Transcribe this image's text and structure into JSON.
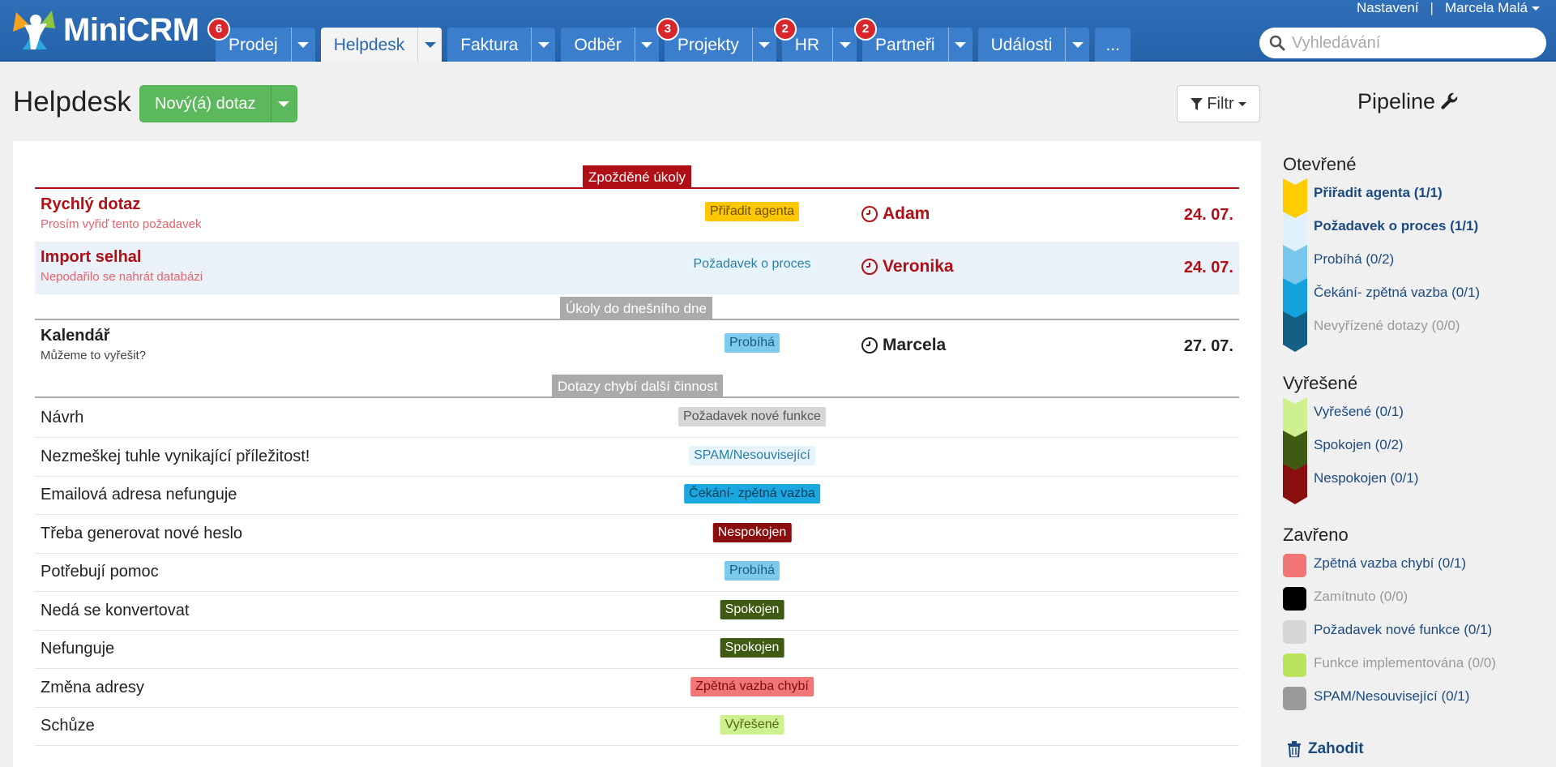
{
  "app": {
    "name": "MiniCRM"
  },
  "nav": {
    "tabs": [
      {
        "label": "Prodej",
        "badge": "6",
        "active": false
      },
      {
        "label": "Helpdesk",
        "badge": "",
        "active": true
      },
      {
        "label": "Faktura",
        "badge": "",
        "active": false
      },
      {
        "label": "Odběr",
        "badge": "",
        "active": false
      },
      {
        "label": "Projekty",
        "badge": "3",
        "active": false
      },
      {
        "label": "HR",
        "badge": "2",
        "active": false
      },
      {
        "label": "Partneři",
        "badge": "2",
        "active": false
      },
      {
        "label": "Události",
        "badge": "",
        "active": false
      }
    ],
    "more_label": "..."
  },
  "userbar": {
    "settings": "Nastavení",
    "separator": "|",
    "user": "Marcela Malá"
  },
  "search": {
    "placeholder": "Vyhledávání"
  },
  "header": {
    "title": "Helpdesk",
    "new_button": "Nový(á) dotaz",
    "filter_button": "Filtr"
  },
  "sections": {
    "overdue": {
      "label": "Zpožděné úkoly",
      "color": "#b00f15",
      "rows": [
        {
          "title": "Rychlý dotaz",
          "subtitle": "Prosím vyřiď tento požadavek",
          "tag": "Přiřadit agenta",
          "tag_bg": "#ffc700",
          "tag_fg": "#6b5000",
          "agent": "Adam",
          "date": "24. 07.",
          "highlight": false
        },
        {
          "title": "Import selhal",
          "subtitle": "Nepodařilo se nahrát databázi",
          "tag": "Požadavek o proces",
          "tag_bg": "#e8f4fb",
          "tag_fg": "#2c7ea8",
          "agent": "Veronika",
          "date": "24. 07.",
          "highlight": true
        }
      ]
    },
    "today": {
      "label": "Úkoly do dnešního dne",
      "color": "#aaaaaa",
      "rows": [
        {
          "title": "Kalendář",
          "subtitle": "Můžeme to vyřešit?",
          "tag": "Probíhá",
          "tag_bg": "#7ccbee",
          "tag_fg": "#1e5a7a",
          "agent": "Marcela",
          "date": "27. 07.",
          "highlight": false
        }
      ]
    },
    "no_activity": {
      "label": "Dotazy chybí další činnost",
      "color": "#aaaaaa",
      "rows": [
        {
          "title": "Návrh",
          "tag": "Požadavek nové funkce",
          "tag_bg": "#d6d6d6",
          "tag_fg": "#555555"
        },
        {
          "title": "Nezmeškej tuhle vynikající příležitost!",
          "tag": "SPAM/Nesouvisející",
          "tag_bg": "#e8f4fb",
          "tag_fg": "#2c7ea8"
        },
        {
          "title": "Emailová adresa nefunguje",
          "tag": "Čekání- zpětná vazba",
          "tag_bg": "#1ba7e0",
          "tag_fg": "#083f5c"
        },
        {
          "title": "Třeba generovat nové heslo",
          "tag": "Nespokojen",
          "tag_bg": "#8b0e0e",
          "tag_fg": "#ffffff"
        },
        {
          "title": "Potřebují pomoc",
          "tag": "Probíhá",
          "tag_bg": "#7ccbee",
          "tag_fg": "#1e5a7a"
        },
        {
          "title": "Nedá se konvertovat",
          "tag": "Spokojen",
          "tag_bg": "#3f5a12",
          "tag_fg": "#ffffff"
        },
        {
          "title": "Nefunguje",
          "tag": "Spokojen",
          "tag_bg": "#3f5a12",
          "tag_fg": "#ffffff"
        },
        {
          "title": "Změna adresy",
          "tag": "Zpětná vazba chybí",
          "tag_bg": "#f27676",
          "tag_fg": "#7a0f0f"
        },
        {
          "title": "Schůze",
          "tag": "Vyřešené",
          "tag_bg": "#cff08e",
          "tag_fg": "#4f6b16"
        }
      ]
    }
  },
  "pipeline": {
    "title": "Pipeline",
    "groups": [
      {
        "title": "Otevřené",
        "kind": "stages",
        "items": [
          {
            "label": "Přiřadit agenta (1/1)",
            "color": "#ffcc00",
            "bold": true,
            "muted": false
          },
          {
            "label": "Požadavek o proces (1/1)",
            "color": "#e1f1fb",
            "bold": true,
            "muted": false
          },
          {
            "label": "Probíhá (0/2)",
            "color": "#78c6ec",
            "bold": false,
            "muted": false
          },
          {
            "label": "Čekání- zpětná vazba (0/1)",
            "color": "#14a2dc",
            "bold": false,
            "muted": false
          },
          {
            "label": "Nevyřízené dotazy (0/0)",
            "color": "#145f84",
            "bold": false,
            "muted": true
          }
        ]
      },
      {
        "title": "Vyřešené",
        "kind": "stages",
        "items": [
          {
            "label": "Vyřešené (0/1)",
            "color": "#cff08e",
            "bold": false,
            "muted": false
          },
          {
            "label": "Spokojen (0/2)",
            "color": "#3f5a12",
            "bold": false,
            "muted": false
          },
          {
            "label": "Nespokojen (0/1)",
            "color": "#8b0e0e",
            "bold": false,
            "muted": false
          }
        ]
      },
      {
        "title": "Zavřeno",
        "kind": "swatches",
        "items": [
          {
            "label": "Zpětná vazba chybí (0/1)",
            "color": "#f27676",
            "bold": false,
            "muted": false
          },
          {
            "label": "Zamítnuto (0/0)",
            "color": "#000000",
            "bold": false,
            "muted": true
          },
          {
            "label": "Požadavek nové funkce (0/1)",
            "color": "#d6d6d6",
            "bold": false,
            "muted": false
          },
          {
            "label": "Funkce implementována (0/0)",
            "color": "#b8e35a",
            "bold": false,
            "muted": true
          },
          {
            "label": "SPAM/Nesouvisející (0/1)",
            "color": "#9a9a9a",
            "bold": false,
            "muted": false
          }
        ]
      }
    ],
    "discard_label": "Zahodit"
  },
  "theme": {
    "link_color": "#1b4a80",
    "muted_color": "#999999",
    "overdue_text": "#b00f15",
    "overdue_sub": "#e6646b",
    "brand_blue": "#2562aa",
    "green": "#5cb85c"
  }
}
